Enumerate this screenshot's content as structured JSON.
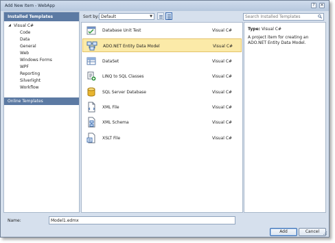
{
  "window": {
    "title": "Add New Item - WebApp",
    "help_glyph": "?",
    "close_glyph": "✕"
  },
  "left": {
    "header": "Installed Templates",
    "root": "Visual C#",
    "root_arrow": "◢",
    "children": [
      "Code",
      "Data",
      "General",
      "Web",
      "Windows Forms",
      "WPF",
      "Reporting",
      "Silverlight",
      "Workflow"
    ],
    "online": "Online Templates"
  },
  "toolbar": {
    "sort_label": "Sort by:",
    "sort_value": "Default",
    "sort_arrow": "▼",
    "search_placeholder": "Search Installed Templates"
  },
  "templates": [
    {
      "name": "Database Unit Test",
      "type": "Visual C#",
      "icon": "unit-test-icon"
    },
    {
      "name": "ADO.NET Entity Data Model",
      "type": "Visual C#",
      "icon": "entity-model-icon",
      "selected": true
    },
    {
      "name": "DataSet",
      "type": "Visual C#",
      "icon": "dataset-icon"
    },
    {
      "name": "LINQ to SQL Classes",
      "type": "Visual C#",
      "icon": "linq-icon"
    },
    {
      "name": "SQL Server Database",
      "type": "Visual C#",
      "icon": "database-icon"
    },
    {
      "name": "XML File",
      "type": "Visual C#",
      "icon": "xml-file-icon"
    },
    {
      "name": "XML Schema",
      "type": "Visual C#",
      "icon": "xml-schema-icon"
    },
    {
      "name": "XSLT File",
      "type": "Visual C#",
      "icon": "xslt-file-icon"
    }
  ],
  "details": {
    "type_label": "Type:",
    "type_value": "Visual C#",
    "description": "A project item for creating an ADO.NET Entity Data Model."
  },
  "bottom": {
    "name_label": "Name:",
    "name_value": "Model1.edmx",
    "add_label": "Add",
    "cancel_label": "Cancel"
  },
  "colors": {
    "header_blue": "#5c7aa3",
    "selection_fill": "#fbeaa8",
    "client_background": "#d6e0ed"
  }
}
